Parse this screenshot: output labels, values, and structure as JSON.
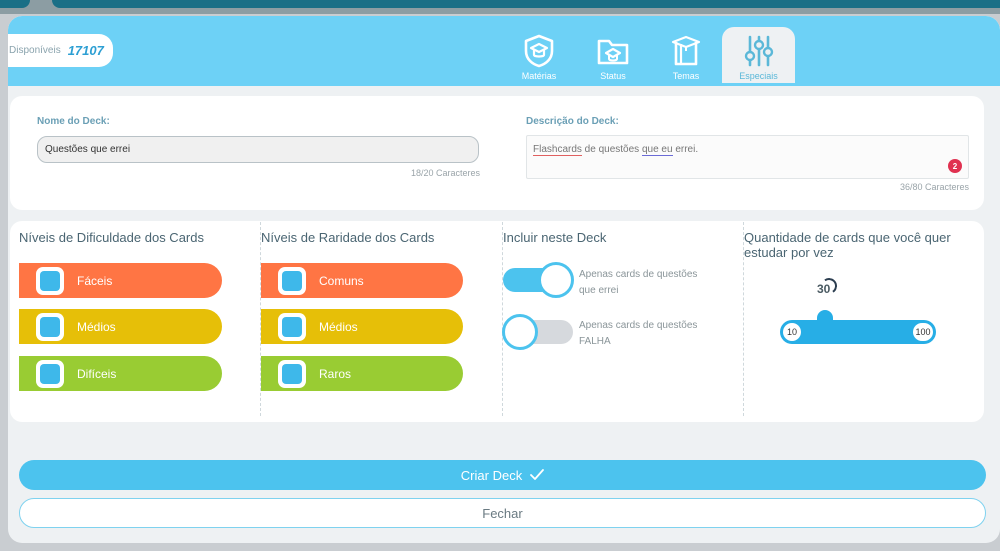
{
  "header": {
    "available_label": "Disponíveis",
    "available_value": "17107",
    "tabs": [
      {
        "label": "Matérias",
        "icon": "shield-graduation-icon",
        "active": false
      },
      {
        "label": "Status",
        "icon": "folder-graduation-icon",
        "active": false
      },
      {
        "label": "Temas",
        "icon": "book-graduation-icon",
        "active": false
      },
      {
        "label": "Especiais",
        "icon": "sliders-icon",
        "active": true
      }
    ]
  },
  "deck": {
    "name_label": "Nome do Deck:",
    "name_value": "Questões que errei",
    "name_counter": "18/20 Caracteres",
    "desc_label": "Descrição do Deck:",
    "desc_parts": [
      "Flashcards",
      " de questões ",
      "que eu",
      " errei."
    ],
    "desc_error_count": "2",
    "desc_counter": "36/80 Caracteres"
  },
  "difficulty": {
    "title": "Níveis de Dificuldade dos Cards",
    "items": [
      {
        "label": "Fáceis",
        "checked": true,
        "color": "#ff7544"
      },
      {
        "label": "Médios",
        "checked": true,
        "color": "#e6bf08"
      },
      {
        "label": "Difíceis",
        "checked": true,
        "color": "#99cc33"
      }
    ]
  },
  "rarity": {
    "title": "Níveis de Raridade dos Cards",
    "items": [
      {
        "label": "Comuns",
        "checked": true,
        "color": "#ff7544"
      },
      {
        "label": "Médios",
        "checked": true,
        "color": "#e6bf08"
      },
      {
        "label": "Raros",
        "checked": true,
        "color": "#99cc33"
      }
    ]
  },
  "include": {
    "title": "Incluir neste Deck",
    "options": [
      {
        "line1": "Apenas cards de questões",
        "line2": "que errei",
        "on": true
      },
      {
        "line1": "Apenas cards de questões",
        "line2": "FALHA",
        "on": false
      }
    ]
  },
  "quantity": {
    "title_line1": "Quantidade de cards que você quer",
    "title_line2": "estudar por vez",
    "value": "30",
    "min": "10",
    "max": "100"
  },
  "actions": {
    "create_label": "Criar Deck",
    "close_label": "Fechar"
  },
  "colors": {
    "accent": "#4cc3ee",
    "header": "#6dd1f6",
    "easy": "#ff7544",
    "medium": "#e6bf08",
    "hard": "#99cc33"
  }
}
